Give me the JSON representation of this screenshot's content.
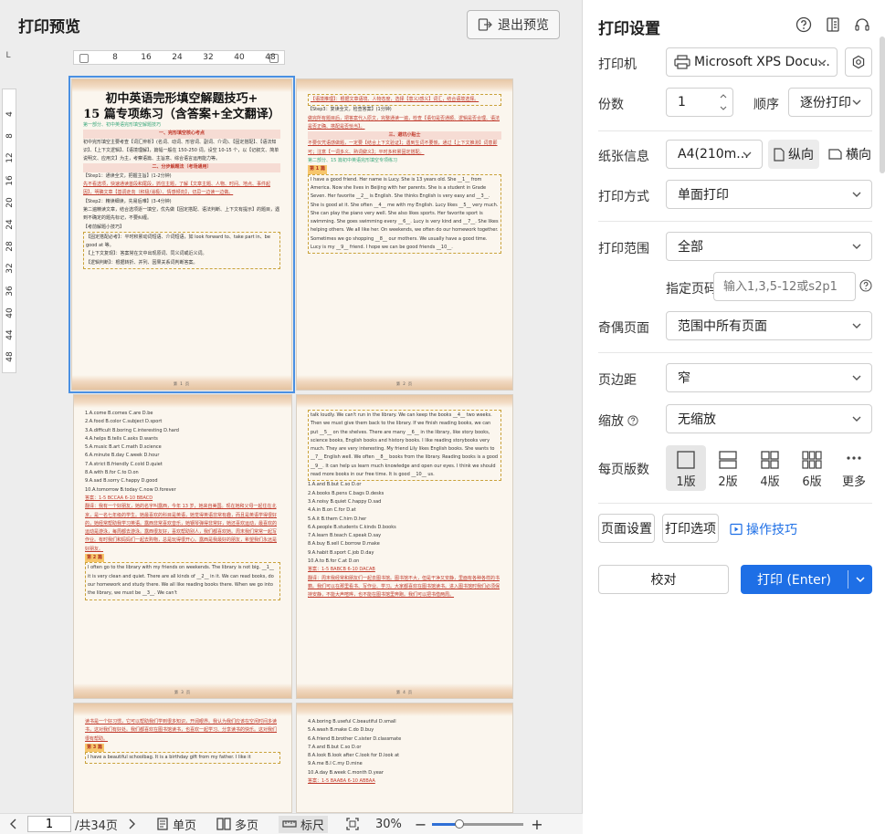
{
  "preview": {
    "title": "打印预览",
    "exit_label": "退出预览",
    "ruler_unit": "L",
    "h_ticks": [
      "8",
      "16",
      "24",
      "32",
      "40",
      "48"
    ],
    "v_ticks": [
      "4",
      "8",
      "12",
      "16",
      "20",
      "24",
      "28",
      "32",
      "36",
      "40",
      "44",
      "48"
    ]
  },
  "pages": {
    "p1": {
      "title_line1": "初中英语完形填空解题技巧+",
      "title_line2": "15 篇专项练习（含答案+全文翻译）",
      "section1": "第一部分、初中英语完形填空解题技巧",
      "h1": "一、完形填空核心考点",
      "para1": "初中完形填空主要考查【词汇辨析】(名词、动词、形容词、副词、介词)、【固定搭配】、【语法知识】、【上下文逻辑】、【语境理解】，篇幅一般在 150-250 词，设空 10-15 个，以【记叙文、简单说明文、应用文】为主，考察语篇、主旨意、综合语言运用能力等。",
      "h2": "二、分步解题法（考场通用）",
      "step1": "【Step1：通读全文，把握主旨】(1-2分钟)",
      "step1_text": "先不看选项，快速通读首段和尾段，抓住主题，了解【文章主题、人物、时间、地点、事件起因】，明确文章【基调走向（积极/消极）、情感倾向】，切忌一边读一边做。",
      "step2": "【Step2：精读细读，先易后难】(3-4分钟)",
      "step2_text": "第二遍精读文章，结合选项逐一填空，优先做【固定搭配、语法判断、上下文有提示】的题目，遇到不确定的题先标记，不要纠缠。",
      "tips": "【考前解题小技巧】",
      "tip1": "【固定搭配必考】：平时积累动词短语、介词短语，如 look forward to、take part in、be good at 等。",
      "tip2": "【上下文复现】：答案常在文中出现原词、同义词或近义词。",
      "tip3": "【逻辑判断】：根据转折、并列、因果关系词判断答案。",
      "page_label": "第 1 页"
    },
    "p2": {
      "top_text": "【语境推理】：根据文章语境、人物态度，选择【意义/感义】词汇，结合语境选择。",
      "step3": "【Step3：复读全文，检查答案】(1分钟)",
      "step3_text": "做完所有题目后，把答案代入原文，完整通读一遍，检查【语句是否通顺、逻辑是否合理、语法是否正确、搭配是否恰当】。",
      "h3": "三、避坑小贴士",
      "avoid_text": "不要仅凭语感做题，一定要【结合上下文验证】；遇到生词不要慌，通过【上下文推测】词意即可；注意【一词多义、熟词僻义】；平时多积累固定搭配。",
      "section2": "第二部分、15 篇初中英语完形填空专项练习",
      "label": "第 1 篇",
      "passage": "I have a good friend. Her name is Lucy. She is 13 years old. She __1__ from America. Now she lives in Beijing with her parents. She is a student in Grade Seven. Her favorite __2__ is English. She thinks English is very easy and __3__. She is good at it. She often __4__ me with my English. Lucy likes __5__ very much. She can play the piano very well. She also likes sports. Her favorite sport is swimming. She goes swimming every __6__. Lucy is very kind and __7__. She likes helping others. We all like her. On weekends, we often do our homework together. Sometimes we go shopping __8__ our mothers. We usually have a good time. Lucy is my __9__ friend. I hope we can be good friends __10__.",
      "page_label": "第 2 页"
    },
    "p3": {
      "options": [
        "1.A.come B.comes C.are D.be",
        "2.A.food B.color C.subject D.sport",
        "3.A.difficult B.boring C.interesting D.hard",
        "4.A.helps B.tells C.asks D.wants",
        "5.A.music B.art C.math D.science",
        "6.A.minute B.day C.week D.hour",
        "7.A.strict B.friendly C.cold D.quiet",
        "8.A.with B.for C.to D.on",
        "9.A.sad B.sorry C.happy D.good",
        "10.A.tomorrow B.today C.now D.forever"
      ],
      "answer": "答案：1-5 BCCAA 6-10 BBACD",
      "translation": "翻译：我有一个好朋友，她的名字叫露西，今年 13 岁，她来自美国。现在她和父母一起住在北京，是一名七年级的学生。她最喜欢的科目是英语，她觉得英语非常有趣，而且是英语学得很好的，她经常帮助我学习英语。露西非常喜欢音乐，她钢琴弹得非常好，她还喜欢运动，最喜欢的运动是游泳，每周都去游泳。露西很友好，喜欢帮助别人，我们都喜欢她。周末我们常常一起写作业。有时我们和妈妈们一起去购物，总是玩得很开心。露西是我最好的朋友，希望我们永远是好朋友。",
      "label": "第 2 篇",
      "passage2": "I often go to the library with my friends on weekends. The library is not big. __1__ it is very clean and quiet. There are all kinds of __2__ in it. We can read books, do our homework and study there. We all like reading books there. When we go into the library, we must be __3__. We can't",
      "page_label": "第 3 页"
    },
    "p4": {
      "passage": "talk loudly. We can't run in the library. We can keep the books __4__ two weeks. Then we must give them back to the library. If we finish reading books, we can put __5__ on the shelves. There are many __6__ in the library, like story books, science books, English books and history books. I like reading storybooks very much. They are very interesting. My friend Lily likes English books. She wants to __7__ English well. We often __8__ books from the library. Reading books is a good __9__. It can help us learn much knowledge and open our eyes. I think we should read more books in our free time. It is good __10__ us.",
      "options": [
        "1.A.and B.but C.so D.or",
        "2.A.books B.pens C.bags D.desks",
        "3.A.noisy B.quiet C.happy D.sad",
        "4.A.in B.on C.for D.at",
        "5.A.it B.them C.him D.her",
        "6.A.people B.students C.kinds D.books",
        "7.A.learn B.teach C.speak D.say",
        "8.A.buy B.sell C.borrow D.make",
        "9.A.habit B.sport C.job D.day",
        "10.A.to B.for C.at D.on"
      ],
      "answer": "答案：1-5 BABCB 6-10 DACAB",
      "translation": "翻译：周末我经常和朋友们一起去图书馆。图书馆不大，但是干净又安静，里面有各种各样的书籍。我们可以在那里看书、写作业、学习。大家都喜欢在图书馆读书。进入图书馆时我们必须保持安静，不能大声喧哗，也不能在图书馆里奔跑。我们可以把书借两周。",
      "page_label": "第 4 页"
    },
    "p5": {
      "translation": "读书是一个好习惯，它可以帮助我们学到很多知识，开阔眼界。我认为我们应该在空闲时间多读书，这对我们有好处。我们都喜欢在图书馆读书，也喜欢一起学习、分享读书的快乐。这对我们很有帮助。",
      "label": "第 3 篇",
      "passage": "I have a beautiful schoolbag. It is a birthday gift from my father. I like it"
    },
    "p6": {
      "options": [
        "4.A.boring B.useful C.beautiful D.small",
        "5.A.wash B.make C.do D.buy",
        "6.A.friend B.brother C.sister D.classmate",
        "7.A.and B.but C.so D.or",
        "8.A.look B.look after C.look for D.look at",
        "9.A.me B.I C.my D.mine",
        "10.A.day B.week C.month D.year"
      ],
      "answer": "答案：1-5 BAABA 6-10 ABBAA"
    }
  },
  "bottom": {
    "page_value": "1",
    "total_pages": "/共34页",
    "single_label": "单页",
    "multi_label": "多页",
    "ruler_label": "标尺",
    "zoom": "30%",
    "zoom_fraction": 0.3
  },
  "panel": {
    "title": "打印设置",
    "printer_label": "打印机",
    "printer_value": "Microsoft XPS Docu...",
    "copies_label": "份数",
    "copies_value": "1",
    "order_label": "顺序",
    "order_value": "逐份打印",
    "paper_label": "纸张信息",
    "paper_value": "A4(210m...",
    "portrait_label": "纵向",
    "landscape_label": "横向",
    "mode_label": "打印方式",
    "mode_value": "单面打印",
    "range_label": "打印范围",
    "range_value": "全部",
    "pages_label": "指定页码",
    "pages_placeholder": "输入1,3,5-12或s2p1",
    "oddeven_label": "奇偶页面",
    "oddeven_value": "范围中所有页面",
    "margin_label": "页边距",
    "margin_value": "窄",
    "scale_label": "缩放",
    "scale_value": "无缩放",
    "perpage_label": "每页版数",
    "layouts": [
      "1版",
      "2版",
      "4版",
      "6版",
      "更多"
    ],
    "page_setup": "页面设置",
    "print_options": "打印选项",
    "tips": "操作技巧",
    "proof": "校对",
    "print": "打印 (Enter)",
    "accent_color": "#1e6fe6"
  }
}
